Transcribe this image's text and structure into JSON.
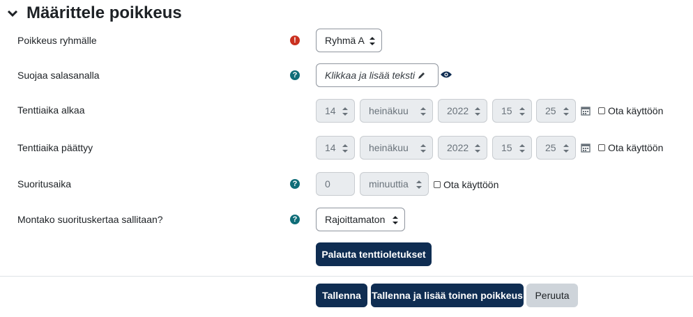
{
  "section": {
    "title": "Määrittele poikkeus"
  },
  "rows": {
    "group": {
      "label": "Poikkeus ryhmälle",
      "value": "Ryhmä A"
    },
    "password": {
      "label": "Suojaa salasanalla",
      "placeholder": "Klikkaa ja lisää teksti"
    },
    "open": {
      "label": "Tenttiaika alkaa",
      "day": "14",
      "month": "heinäkuu",
      "year": "2022",
      "hour": "15",
      "minute": "25",
      "enable": "Ota käyttöön"
    },
    "close": {
      "label": "Tenttiaika päättyy",
      "day": "14",
      "month": "heinäkuu",
      "year": "2022",
      "hour": "15",
      "minute": "25",
      "enable": "Ota käyttöön"
    },
    "timelimit": {
      "label": "Suoritusaika",
      "value": "0",
      "unit": "minuuttia",
      "enable": "Ota käyttöön"
    },
    "attempts": {
      "label": "Montako suorituskertaa sallitaan?",
      "value": "Rajoittamaton"
    }
  },
  "buttons": {
    "revert": "Palauta tenttioletukset",
    "save": "Tallenna",
    "save_add": "Tallenna ja lisää toinen poikkeus",
    "cancel": "Peruuta"
  },
  "colors": {
    "primary": "#0f2d52",
    "error": "#ca3120",
    "help": "#0f6d78"
  }
}
